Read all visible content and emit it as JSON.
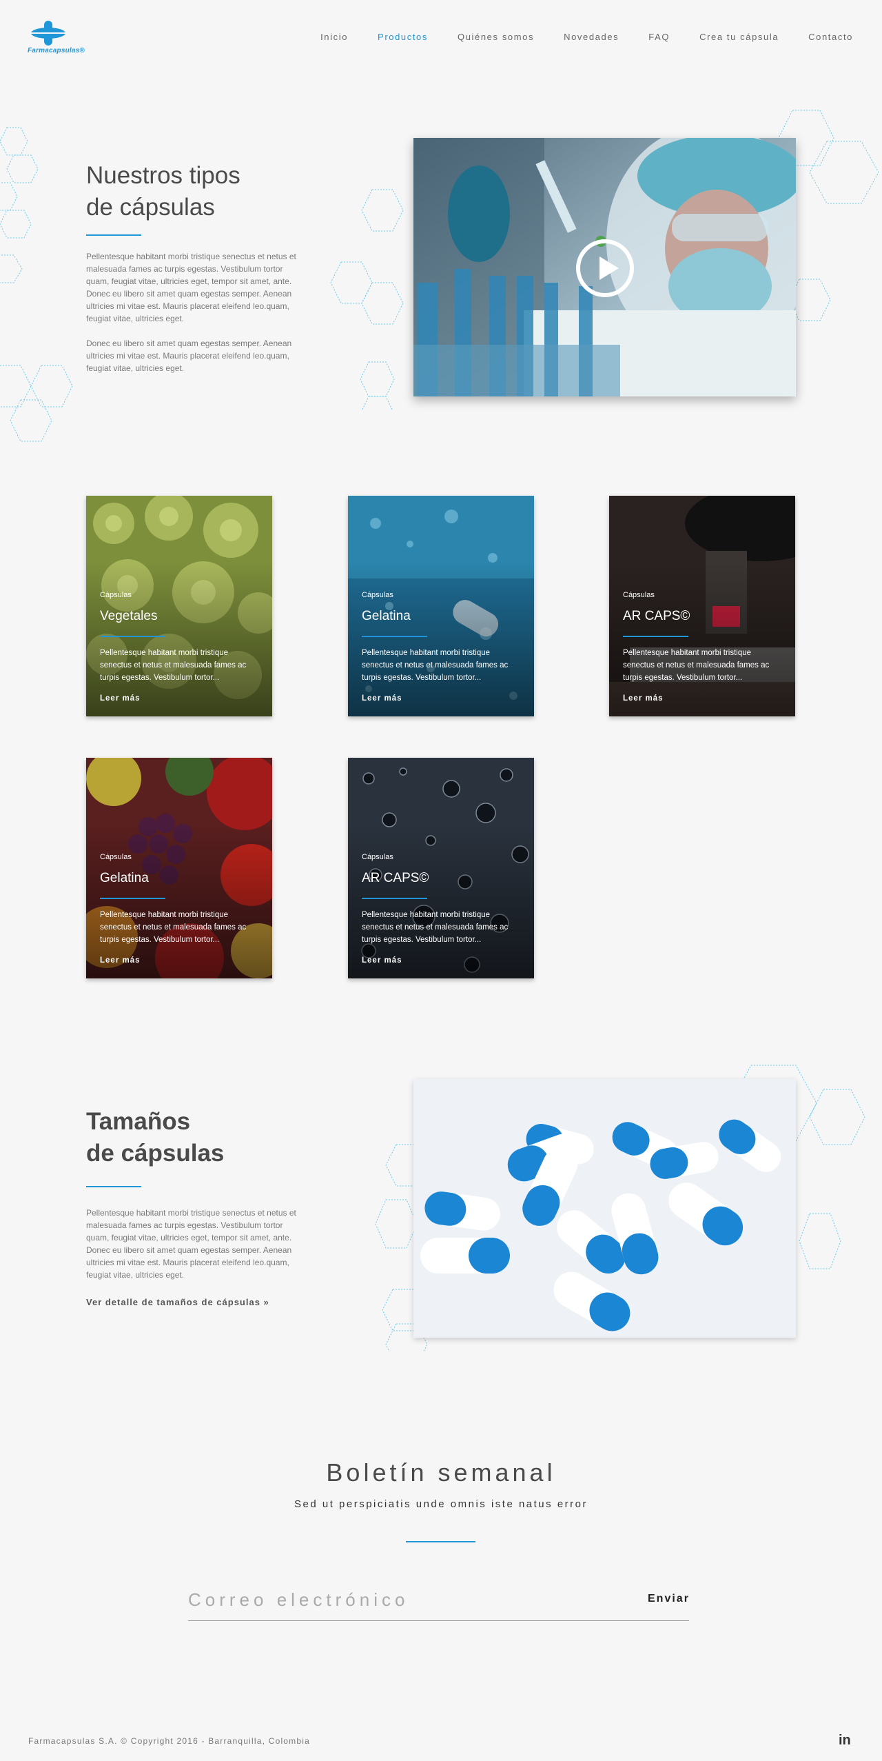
{
  "header": {
    "logo_text": "Farmacapsulas®",
    "nav": [
      {
        "label": "Inicio"
      },
      {
        "label": "Productos"
      },
      {
        "label": "Quiénes somos"
      },
      {
        "label": "Novedades"
      },
      {
        "label": "FAQ"
      },
      {
        "label": "Crea tu cápsula"
      },
      {
        "label": "Contacto"
      }
    ],
    "active": "Productos"
  },
  "types": {
    "title_1": "Nuestros tipos",
    "title_2": "de cápsulas",
    "para_1": "Pellentesque habitant morbi tristique senectus et netus et malesuada fames ac turpis egestas. Vestibulum tortor quam, feugiat vitae, ultricies eget, tempor sit amet, ante. Donec eu libero sit amet quam egestas semper. Aenean ultricies mi vitae est. Mauris placerat eleifend leo.quam, feugiat vitae, ultricies eget.",
    "para_2": "Donec eu libero sit amet quam egestas semper. Aenean ultricies mi vitae est. Mauris placerat eleifend leo.quam, feugiat vitae, ultricies eget."
  },
  "cards": [
    {
      "category": "Cápsulas",
      "title": "Vegetales",
      "text": "Pellentesque habitant morbi tristique senectus et netus et malesuada fames ac turpis egestas. Vestibulum tortor...",
      "link": "Leer más"
    },
    {
      "category": "Cápsulas",
      "title": "Gelatina",
      "text": "Pellentesque habitant morbi tristique senectus et netus et malesuada fames ac turpis egestas. Vestibulum tortor...",
      "link": "Leer más"
    },
    {
      "category": "Cápsulas",
      "title": "AR CAPS©",
      "text": "Pellentesque habitant morbi tristique senectus et netus et malesuada fames ac turpis egestas. Vestibulum tortor...",
      "link": "Leer más"
    },
    {
      "category": "Cápsulas",
      "title": "Gelatina",
      "text": "Pellentesque habitant morbi tristique senectus et netus et malesuada fames ac turpis egestas. Vestibulum tortor...",
      "link": "Leer más"
    },
    {
      "category": "Cápsulas",
      "title": "AR CAPS©",
      "text": "Pellentesque habitant morbi tristique senectus et netus et malesuada fames ac turpis egestas. Vestibulum tortor...",
      "link": "Leer más"
    }
  ],
  "sizes": {
    "title_1": "Tamaños",
    "title_2": "de cápsulas",
    "para": "Pellentesque habitant morbi tristique senectus et netus et malesuada fames ac turpis egestas. Vestibulum tortor quam, feugiat vitae, ultricies eget, tempor sit amet, ante. Donec eu libero sit amet quam egestas semper. Aenean ultricies mi vitae est. Mauris placerat eleifend leo.quam, feugiat vitae, ultricies eget.",
    "link": "Ver detalle de tamaños de cápsulas   »"
  },
  "newsletter": {
    "title": "Boletín semanal",
    "subtitle": "Sed ut perspiciatis unde omnis iste natus error",
    "placeholder": "Correo electrónico",
    "button": "Enviar"
  },
  "footer": {
    "copyright": "Farmacapsulas S.A. © Copyright 2016 - Barranquilla, Colombia",
    "social": "in"
  },
  "colors": {
    "accent": "#1e96d8",
    "background": "#f6f6f6"
  },
  "icons": [
    "logo-capsule-icon",
    "play-icon",
    "linkedin-icon"
  ]
}
